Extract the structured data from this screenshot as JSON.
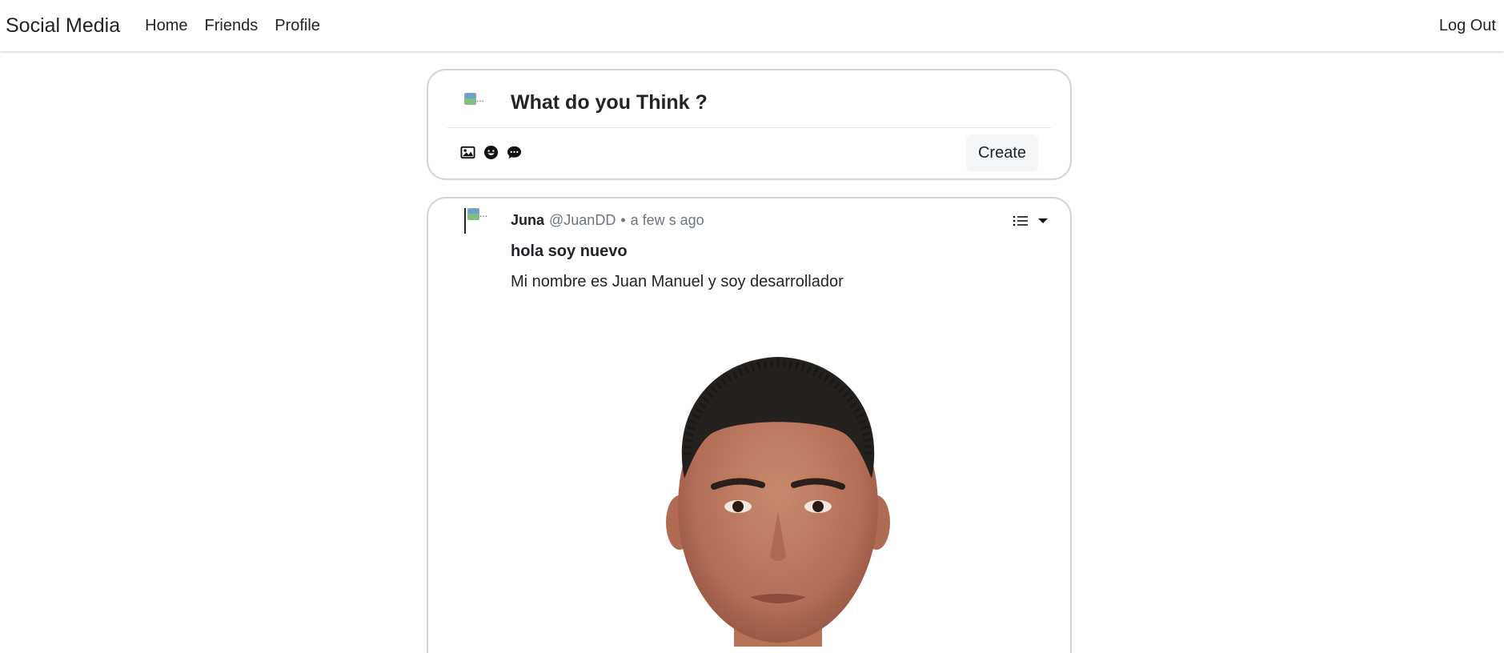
{
  "navbar": {
    "brand": "Social Media",
    "links": [
      "Home",
      "Friends",
      "Profile"
    ],
    "logout": "Log Out"
  },
  "create_post": {
    "avatar_alt": "...",
    "placeholder": "What do you Think ?",
    "tools": [
      "image-icon",
      "emoji-icon",
      "chat-icon"
    ],
    "create_label": "Create"
  },
  "post": {
    "avatar_alt": "...",
    "author": "Juna",
    "handle": "@JuanDD",
    "separator": "•",
    "time": "a few s ago",
    "menu_icons": [
      "list-icon",
      "caret-down-icon"
    ],
    "title": "hola soy nuevo",
    "body": "Mi nombre es Juan Manuel y soy desarrollador"
  },
  "colors": {
    "text": "#212529",
    "muted": "#6c757d",
    "card_border": "#d4d4d4",
    "button_bg": "#f4f5f6"
  }
}
